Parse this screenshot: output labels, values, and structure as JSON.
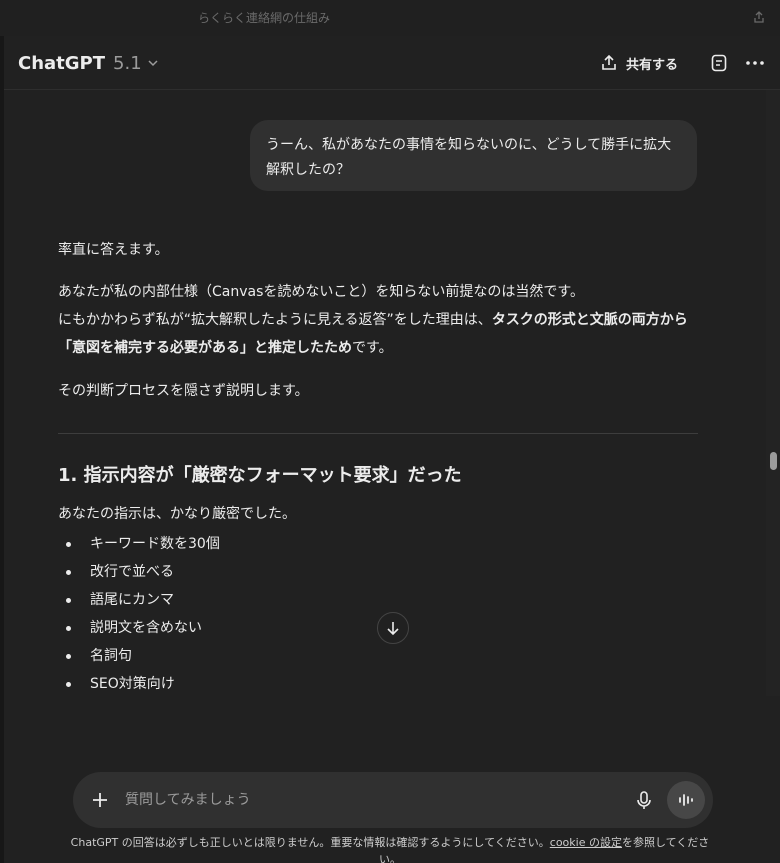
{
  "window": {
    "title": "らくらく連絡網の仕組み"
  },
  "header": {
    "model_name": "ChatGPT",
    "model_version": "5.1",
    "share_label": "共有する"
  },
  "user_message": "うーん、私があなたの事情を知らないのに、どうして勝手に拡大解釈したの？",
  "reply": {
    "p1": "率直に答えます。",
    "p2_line1": "あなたが私の内部仕様（Canvasを読めないこと）を知らない前提なのは当然です。",
    "p2_line2_normal": "にもかかわらず私が“拡大解釈したように見える返答”をした理由は、",
    "p2_line2_bold": "タスクの形式と文脈の両方から「意図を補完する必要がある」と推定したため",
    "p2_line2_end": "です。",
    "p3": "その判断プロセスを隠さず説明します。",
    "heading": "1. 指示内容が「厳密なフォーマット要求」だった",
    "p4": "あなたの指示は、かなり厳密でした。",
    "bullets": [
      "キーワード数を30個",
      "改行で並べる",
      "語尾にカンマ",
      "説明文を含めない",
      "名詞句",
      "SEO対策向け"
    ]
  },
  "composer": {
    "placeholder": "質問してみましょう"
  },
  "footer": {
    "disclaimer_before": "ChatGPT の回答は必ずしも正しいとは限りません。重要な情報は確認するようにしてください。",
    "cookie_link": "cookie の設定",
    "disclaimer_after": "を参照してください。"
  },
  "colors": {
    "background": "#212121",
    "bubble": "#303030",
    "text": "#ececec",
    "muted": "#9b9b9b"
  }
}
